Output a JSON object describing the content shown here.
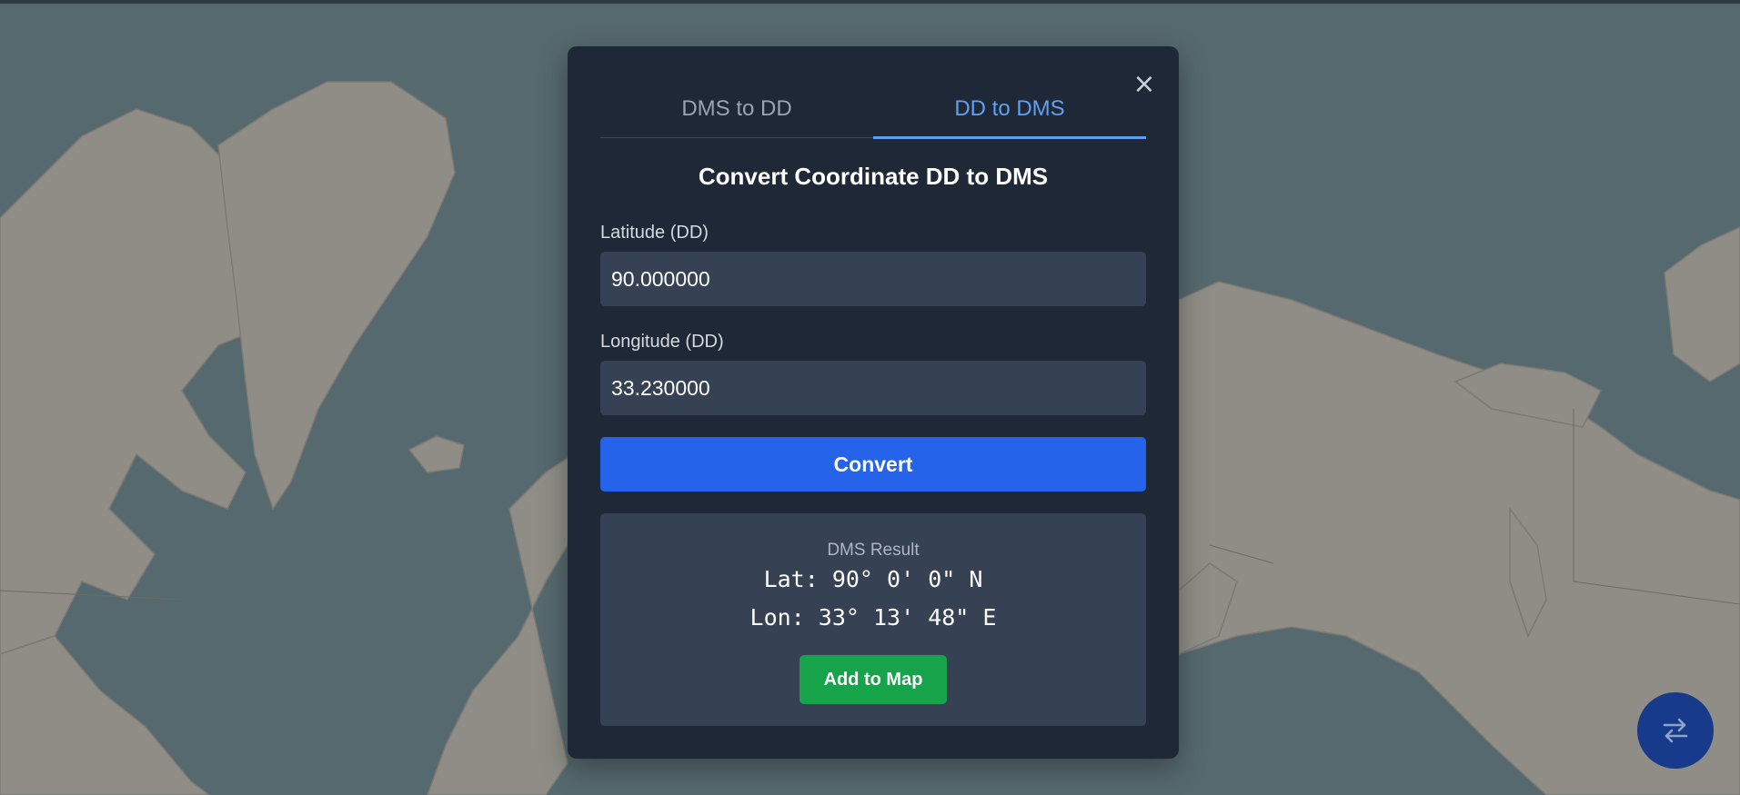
{
  "dialog": {
    "tabs": [
      {
        "label": "DMS to DD",
        "active": false
      },
      {
        "label": "DD to DMS",
        "active": true
      }
    ],
    "close_glyph": "×",
    "title": "Convert Coordinate DD to DMS",
    "latitude": {
      "label": "Latitude (DD)",
      "value": "90.000000"
    },
    "longitude": {
      "label": "Longitude (DD)",
      "value": "33.230000"
    },
    "convert_label": "Convert",
    "result": {
      "label": "DMS Result",
      "lat_line": "Lat: 90° 0' 0\" N",
      "lon_line": "Lon: 33° 13' 48\" E",
      "add_label": "Add to Map"
    }
  },
  "fab": {
    "icon": "swap-arrows-icon"
  },
  "colors": {
    "ocean": "#56696f",
    "land": "#8f8d86",
    "modal_bg": "#1f2837",
    "accent_blue": "#5fa0f3",
    "convert_button": "#2563eb",
    "add_button": "#16a34a",
    "fab_bg": "#173a8a"
  }
}
